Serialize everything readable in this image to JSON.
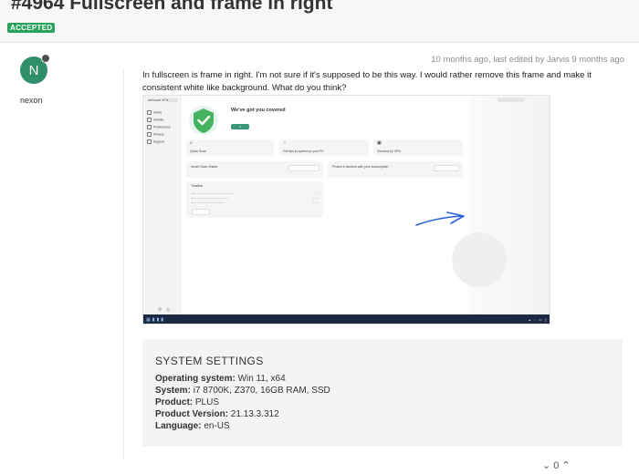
{
  "topic": {
    "title": "#4964 Fullscreen and frame in right",
    "status": "ACCEPTED"
  },
  "post": {
    "author": "nexon",
    "avatar_letter": "N",
    "meta": "10 months ago, last edited by Jarvis 9 months ago",
    "body": "In fullscreen is frame in right. I'm not sure if it's supposed to be this way. I would rather remove this frame and make it consistent white like background. What do you think?",
    "votes": "0"
  },
  "screenshot": {
    "app_name": "AdGuard VPN",
    "sidebar_items": [
      "Home",
      "Activity",
      "Preferences",
      "Privacy",
      "Support"
    ],
    "hero_title": "We've got you covered",
    "cards": [
      "Quick Scan",
      "Get tips to speed up your PC",
      "Secured by VPN"
    ],
    "row2_left": "Smart Scan Shield",
    "row2_right": "Protect 5 devices with your subscription",
    "activity_title": "Timeline"
  },
  "settings": {
    "title": "SYSTEM SETTINGS",
    "rows": [
      {
        "label": "Operating system:",
        "value": "Win 11, x64"
      },
      {
        "label": "System:",
        "value": "i7 8700K, Z370, 16GB RAM, SSD"
      },
      {
        "label": "Product:",
        "value": "PLUS"
      },
      {
        "label": "Product Version:",
        "value": "21.13.3.312"
      },
      {
        "label": "Language:",
        "value": "en-US"
      }
    ]
  },
  "colors": {
    "accent_green": "#27a35c",
    "avatar": "#2f8f6b",
    "taskbar": "#1b2a44",
    "annotation": "#2b5fd9"
  }
}
